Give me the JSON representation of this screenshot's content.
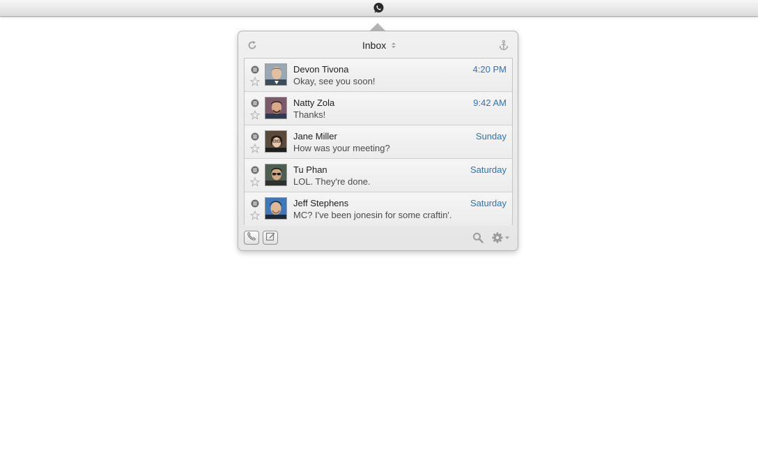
{
  "menubar": {
    "app_icon": "whatsapp-icon"
  },
  "popover": {
    "header": {
      "title": "Inbox",
      "refresh_icon": "refresh-icon",
      "anchor_icon": "anchor-icon"
    },
    "conversations": [
      {
        "name": "Devon Tivona",
        "message": "Okay, see you soon!",
        "time": "4:20 PM"
      },
      {
        "name": "Natty Zola",
        "message": "Thanks!",
        "time": "9:42 AM"
      },
      {
        "name": "Jane Miller",
        "message": "How was your meeting?",
        "time": "Sunday"
      },
      {
        "name": "Tu Phan",
        "message": "LOL. They're done.",
        "time": "Saturday"
      },
      {
        "name": "Jeff Stephens",
        "message": "MC? I've been jonesin for some craftin'.",
        "time": "Saturday"
      }
    ],
    "footer": {
      "call_icon": "phone-icon",
      "compose_icon": "compose-icon",
      "search_icon": "search-icon",
      "settings_icon": "gear-icon"
    }
  },
  "colors": {
    "time_accent": "#2a73c5",
    "menubar_bg": "#e8e8e8"
  }
}
